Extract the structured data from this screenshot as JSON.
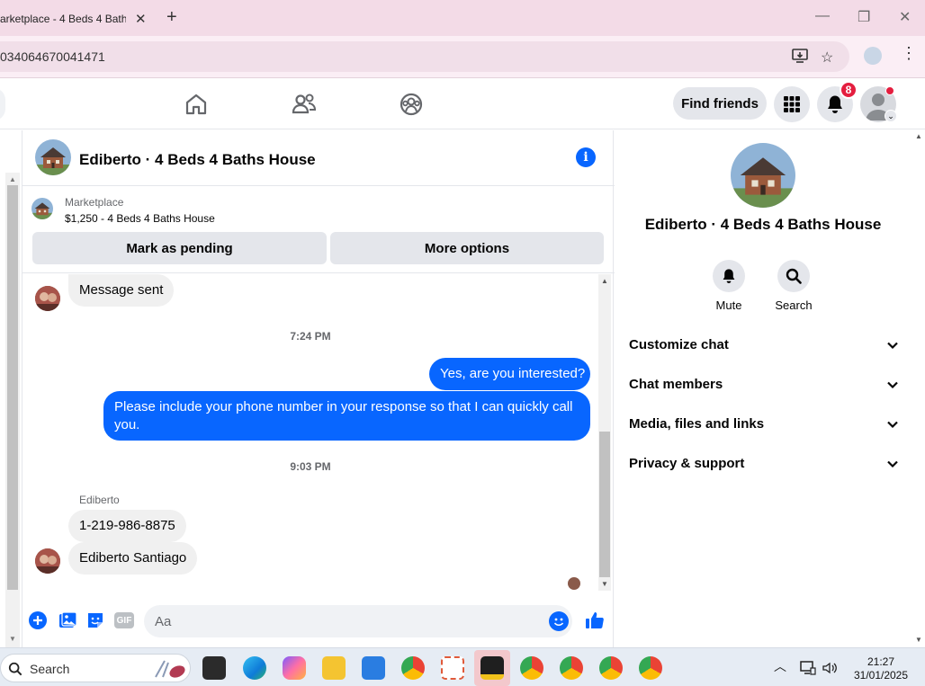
{
  "browser": {
    "tab_title": "arketplace - 4 Beds 4 Bath",
    "tab_close": "✕",
    "new_tab": "+",
    "url": "034064670041471"
  },
  "header": {
    "find_friends": "Find friends",
    "notification_count": "8"
  },
  "chat": {
    "title": "Ediberto · 4 Beds 4 Baths House",
    "marketplace_label": "Marketplace",
    "listing": "$1,250 - 4 Beds 4 Baths House",
    "mark_pending": "Mark as pending",
    "more_options": "More options",
    "messages": {
      "msg_sent": "Message sent",
      "time1": "7:24 PM",
      "out1": "Yes, are you interested?",
      "out2": "Please include your phone number in your response so that I can quickly call you.",
      "time2": "9:03 PM",
      "sender": "Ediberto",
      "in1": "1-219-986-8875",
      "in2": "Ediberto Santiago"
    },
    "composer_placeholder": "Aa",
    "gif_label": "GIF"
  },
  "panel": {
    "title": "Ediberto · 4 Beds 4 Baths House",
    "mute": "Mute",
    "search": "Search",
    "rows": [
      "Customize chat",
      "Chat members",
      "Media, files and links",
      "Privacy & support"
    ]
  },
  "taskbar": {
    "search_placeholder": "Search",
    "time": "21:27",
    "date": "31/01/2025"
  },
  "colors": {
    "messenger_blue": "#0866ff",
    "badge_red": "#e41e3f",
    "tab_strip": "#f3dbe7"
  }
}
